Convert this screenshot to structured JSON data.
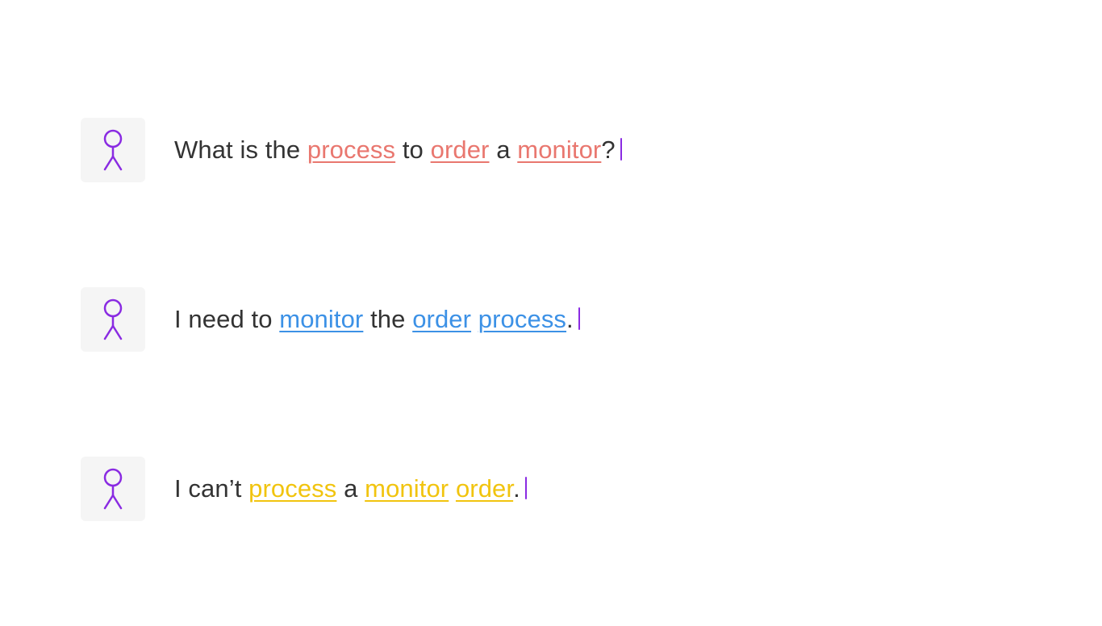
{
  "colors": {
    "avatar_bg": "#f5f5f5",
    "avatar_stroke": "#8a2be2",
    "cursor": "#8a2be2",
    "text": "#333333",
    "highlight_red": "#e9776f",
    "highlight_blue": "#3c91e6",
    "highlight_yellow": "#f1c40f"
  },
  "rows": [
    {
      "highlight": "red",
      "tokens": [
        "What is the ",
        "process",
        " to ",
        "order",
        " a ",
        "monitor",
        "?"
      ],
      "highlighted_tokens": [
        1,
        3,
        5
      ]
    },
    {
      "highlight": "blue",
      "tokens": [
        "I need to ",
        "monitor",
        " the ",
        "order",
        " ",
        "process",
        "."
      ],
      "highlighted_tokens": [
        1,
        3,
        5
      ]
    },
    {
      "highlight": "yellow",
      "tokens": [
        "I can’t ",
        "process",
        " a ",
        "monitor",
        " ",
        "order",
        "."
      ],
      "highlighted_tokens": [
        1,
        3,
        5
      ]
    }
  ],
  "text": {
    "row0": {
      "t0": "What is the ",
      "t1": "process",
      "t2": " to ",
      "t3": "order",
      "t4": " a ",
      "t5": "monitor",
      "t6": "?"
    },
    "row1": {
      "t0": "I need to ",
      "t1": "monitor",
      "t2": " the ",
      "t3": "order",
      "t4": " ",
      "t5": "process",
      "t6": "."
    },
    "row2": {
      "t0": "I can’t ",
      "t1": "process",
      "t2": " a ",
      "t3": "monitor",
      "t4": " ",
      "t5": "order",
      "t6": "."
    }
  }
}
